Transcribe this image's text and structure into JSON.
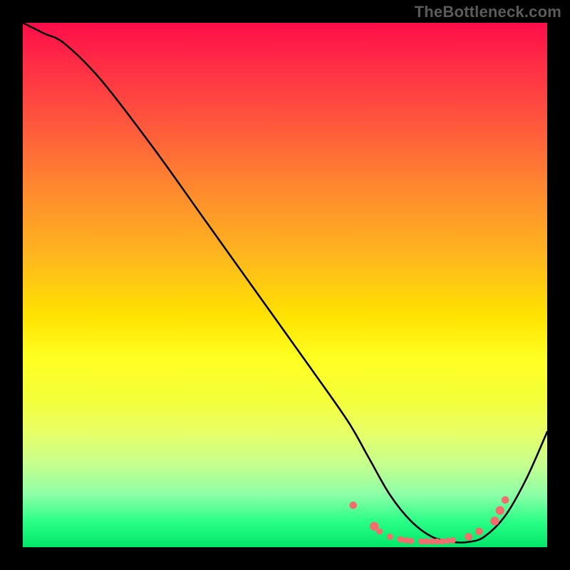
{
  "watermark": "TheBottleneck.com",
  "chart_data": {
    "type": "line",
    "title": "",
    "xlabel": "",
    "ylabel": "",
    "xlim": [
      0,
      100
    ],
    "ylim": [
      0,
      100
    ],
    "series": [
      {
        "name": "curve",
        "x": [
          0,
          4,
          8,
          15,
          25,
          35,
          45,
          55,
          62,
          66,
          70,
          74,
          78,
          82,
          85,
          88,
          92,
          96,
          100
        ],
        "y": [
          100,
          98,
          96,
          89,
          76,
          62,
          48,
          34,
          24,
          17,
          10,
          5,
          2,
          1,
          1,
          2,
          6,
          13,
          22
        ]
      }
    ],
    "markers": {
      "name": "bottom-cluster",
      "x": [
        63,
        67,
        68,
        70,
        72,
        73,
        74,
        76,
        77,
        78,
        79,
        80,
        81,
        82,
        85,
        87,
        90,
        91,
        92
      ],
      "y": [
        8,
        4,
        3,
        2,
        1.5,
        1.3,
        1.2,
        1.1,
        1.1,
        1.1,
        1.1,
        1.1,
        1.2,
        1.3,
        2,
        3,
        5,
        7,
        9
      ],
      "radius": [
        6,
        7,
        5,
        5,
        5,
        5,
        5,
        5,
        5,
        5,
        5,
        5,
        5,
        5,
        6,
        6,
        7,
        7,
        6
      ]
    }
  }
}
